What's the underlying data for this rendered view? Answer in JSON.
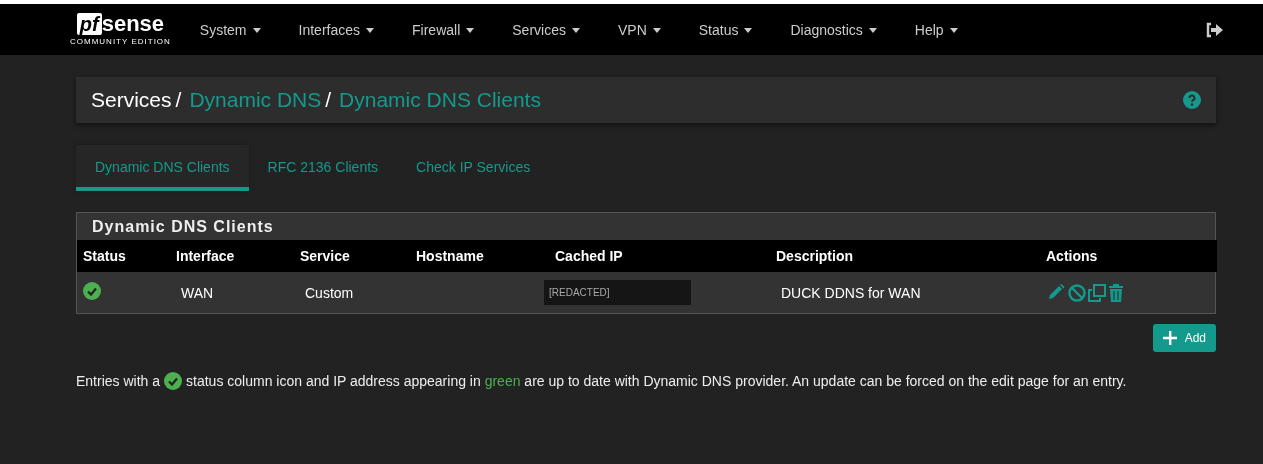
{
  "brand": {
    "mark": "pf",
    "name": "sense",
    "edition": "COMMUNITY EDITION"
  },
  "menu": [
    {
      "label": "System"
    },
    {
      "label": "Interfaces"
    },
    {
      "label": "Firewall"
    },
    {
      "label": "Services"
    },
    {
      "label": "VPN"
    },
    {
      "label": "Status"
    },
    {
      "label": "Diagnostics"
    },
    {
      "label": "Help"
    }
  ],
  "breadcrumb_separator": "/",
  "breadcrumb": [
    {
      "label": "Services",
      "link": false
    },
    {
      "label": "Dynamic DNS",
      "link": true
    },
    {
      "label": "Dynamic DNS Clients",
      "link": true
    }
  ],
  "tabs": [
    {
      "label": "Dynamic DNS Clients",
      "selected": true
    },
    {
      "label": "RFC 2136 Clients",
      "selected": false
    },
    {
      "label": "Check IP Services",
      "selected": false
    }
  ],
  "table": {
    "title": "Dynamic DNS Clients",
    "columns": [
      "Status",
      "Interface",
      "Service",
      "Hostname",
      "Cached IP",
      "Description",
      "Actions"
    ],
    "rows": [
      {
        "status_ok": true,
        "interface": "WAN",
        "service": "Custom",
        "cached_ip": "[REDACTED]",
        "description": "DUCK DDNS for WAN"
      }
    ]
  },
  "add_button": "Add",
  "note": {
    "before": "Entries with a",
    "after": "status column icon and IP address appearing in",
    "highlight": "green",
    "rest": "are up to date with Dynamic DNS provider. An update can be forced on the edit page for an entry."
  }
}
